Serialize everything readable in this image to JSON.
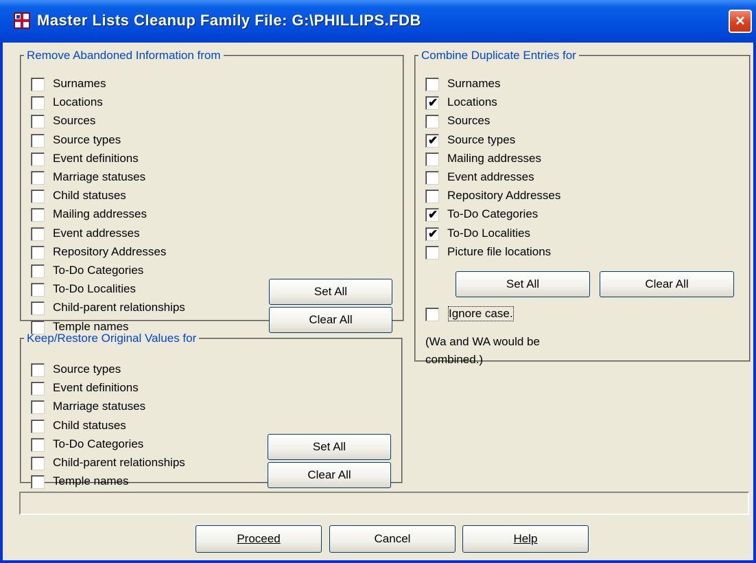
{
  "window": {
    "title": "Master Lists Cleanup Family File: G:\\PHILLIPS.FDB",
    "close_icon": "×"
  },
  "remove_abandoned": {
    "legend": "Remove Abandoned Information from",
    "items": [
      {
        "label": "Surnames",
        "checked": false
      },
      {
        "label": "Locations",
        "checked": false
      },
      {
        "label": "Sources",
        "checked": false
      },
      {
        "label": "Source types",
        "checked": false
      },
      {
        "label": "Event definitions",
        "checked": false
      },
      {
        "label": "Marriage statuses",
        "checked": false
      },
      {
        "label": "Child statuses",
        "checked": false
      },
      {
        "label": "Mailing addresses",
        "checked": false
      },
      {
        "label": "Event addresses",
        "checked": false
      },
      {
        "label": "Repository Addresses",
        "checked": false
      },
      {
        "label": "To-Do Categories",
        "checked": false
      },
      {
        "label": "To-Do Localities",
        "checked": false
      },
      {
        "label": "Child-parent relationships",
        "checked": false
      },
      {
        "label": "Temple names",
        "checked": false
      }
    ],
    "set_all": "Set All",
    "clear_all": "Clear All"
  },
  "keep_restore": {
    "legend": "Keep/Restore Original Values for",
    "items": [
      {
        "label": "Source types",
        "checked": false
      },
      {
        "label": "Event definitions",
        "checked": false
      },
      {
        "label": "Marriage statuses",
        "checked": false
      },
      {
        "label": "Child statuses",
        "checked": false
      },
      {
        "label": "To-Do Categories",
        "checked": false
      },
      {
        "label": "Child-parent relationships",
        "checked": false
      },
      {
        "label": "Temple names",
        "checked": false
      }
    ],
    "set_all": "Set All",
    "clear_all": "Clear All"
  },
  "combine_duplicates": {
    "legend": "Combine Duplicate Entries for",
    "items": [
      {
        "label": "Surnames",
        "checked": false
      },
      {
        "label": "Locations",
        "checked": true
      },
      {
        "label": "Sources",
        "checked": false
      },
      {
        "label": "Source types",
        "checked": true
      },
      {
        "label": "Mailing addresses",
        "checked": false
      },
      {
        "label": "Event addresses",
        "checked": false
      },
      {
        "label": "Repository Addresses",
        "checked": false
      },
      {
        "label": "To-Do Categories",
        "checked": true
      },
      {
        "label": "To-Do Localities",
        "checked": true
      },
      {
        "label": "Picture file locations",
        "checked": false
      }
    ],
    "set_all": "Set All",
    "clear_all": "Clear All",
    "ignore_case": {
      "label": "Ignore case.",
      "checked": false
    },
    "note_line1": "(Wa and WA would be",
    "note_line2": "combined.)"
  },
  "status_bar": {
    "text": ""
  },
  "footer": {
    "proceed": "Proceed",
    "cancel": "Cancel",
    "help": "Help"
  }
}
